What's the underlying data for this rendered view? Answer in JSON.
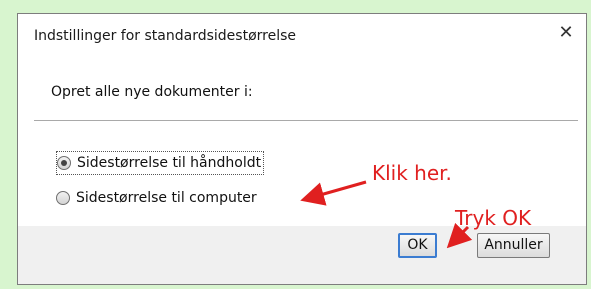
{
  "dialog": {
    "title": "Indstillinger for standardsidestørrelse",
    "close_glyph": "✕",
    "prompt": "Opret alle nye dokumenter i:",
    "options": [
      {
        "label": "Sidestørrelse til håndholdt",
        "selected": true
      },
      {
        "label": "Sidestørrelse til computer",
        "selected": false
      }
    ],
    "ok_label": "OK",
    "cancel_label": "Annuller"
  },
  "annotations": {
    "click_here": "Klik her.",
    "press_ok": "Tryk OK",
    "color": "#e02020"
  },
  "colors": {
    "page_background": "#d8f5cf",
    "footer_background": "#f0f0f0",
    "focus_border": "#3b7cd1"
  }
}
